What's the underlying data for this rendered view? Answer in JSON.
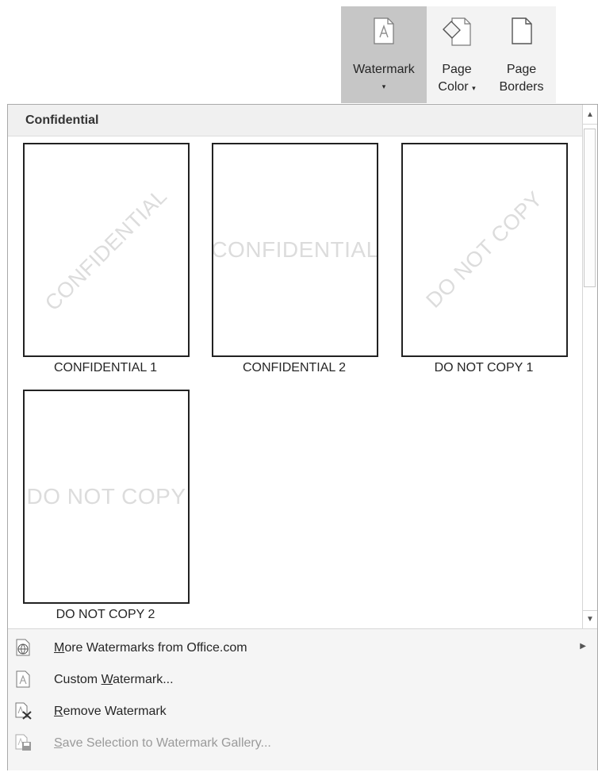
{
  "ribbon": {
    "watermark_label": "Watermark",
    "watermark_caret": "▾",
    "page_color_label_1": "Page",
    "page_color_label_2": "Color",
    "page_color_caret": "▾",
    "page_borders_label_1": "Page",
    "page_borders_label_2": "Borders"
  },
  "gallery": {
    "section_title": "Confidential",
    "items": [
      {
        "label": "CONFIDENTIAL 1",
        "watermark_text": "CONFIDENTIAL",
        "orientation": "diagonal"
      },
      {
        "label": "CONFIDENTIAL 2",
        "watermark_text": "CONFIDENTIAL",
        "orientation": "horizontal"
      },
      {
        "label": "DO NOT COPY 1",
        "watermark_text": "DO NOT COPY",
        "orientation": "diagonal"
      },
      {
        "label": "DO NOT COPY 2",
        "watermark_text": "DO NOT COPY",
        "orientation": "horizontal"
      }
    ]
  },
  "menu": {
    "more": {
      "accel": "M",
      "rest": "ore Watermarks from Office.com",
      "icon": "globe-page-icon"
    },
    "custom": {
      "pre": "Custom ",
      "accel": "W",
      "rest": "atermark...",
      "icon": "watermark-page-icon"
    },
    "remove": {
      "accel": "R",
      "rest": "emove Watermark",
      "icon": "remove-watermark-icon"
    },
    "save": {
      "accel": "S",
      "rest": "ave Selection to Watermark Gallery...",
      "icon": "save-to-gallery-icon"
    }
  }
}
